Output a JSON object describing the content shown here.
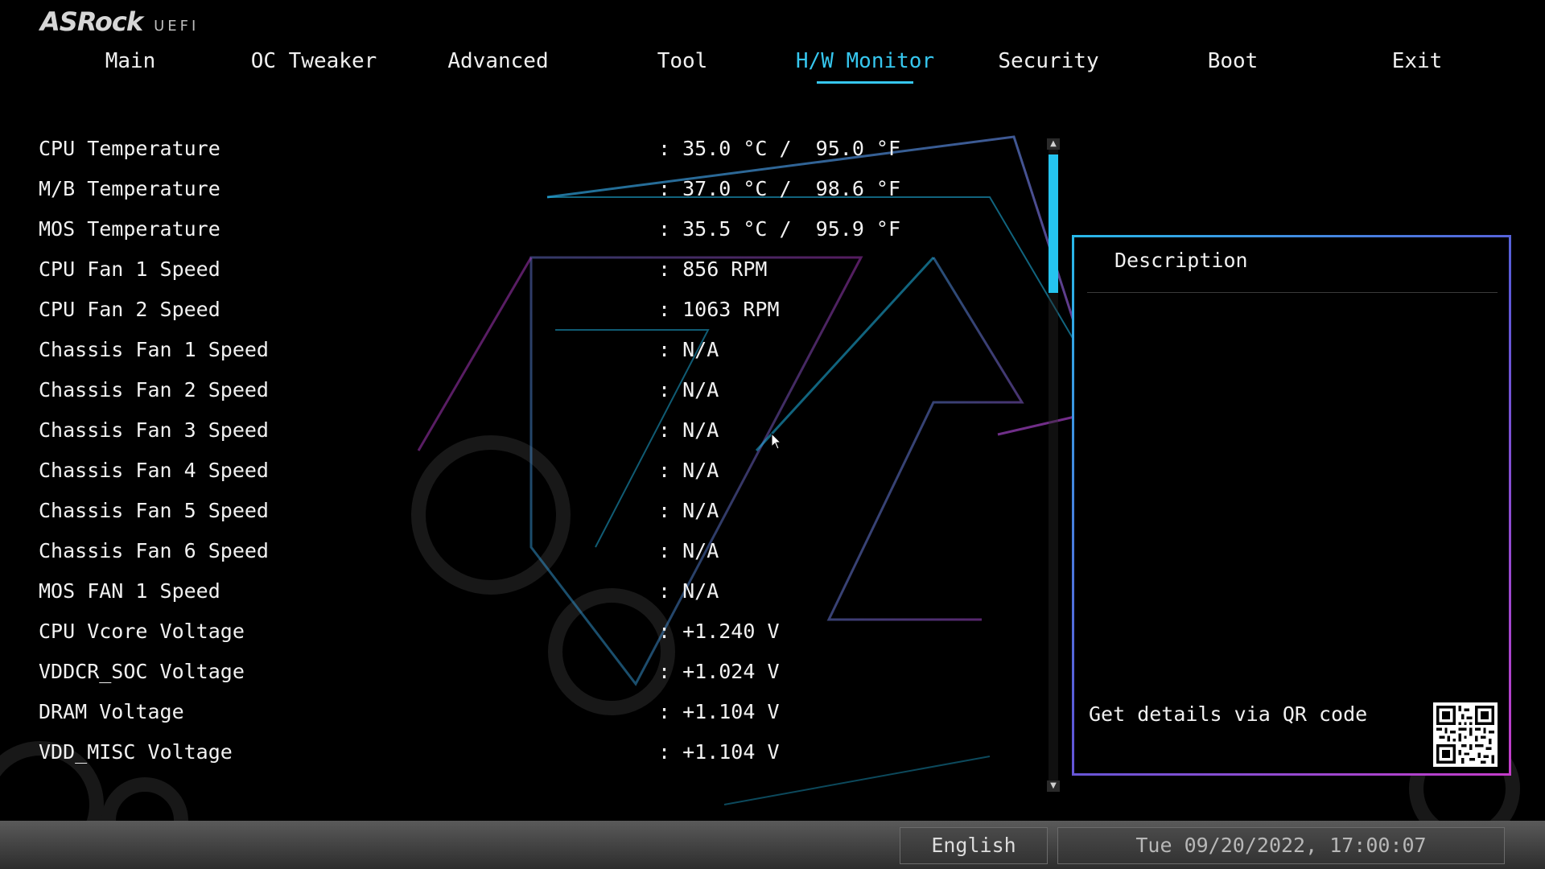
{
  "logo": {
    "brand": "ASRock",
    "product": "UEFI"
  },
  "menu": {
    "tabs": [
      {
        "label": "Main",
        "active": false
      },
      {
        "label": "OC Tweaker",
        "active": false
      },
      {
        "label": "Advanced",
        "active": false
      },
      {
        "label": "Tool",
        "active": false
      },
      {
        "label": "H/W Monitor",
        "active": true
      },
      {
        "label": "Security",
        "active": false
      },
      {
        "label": "Boot",
        "active": false
      },
      {
        "label": "Exit",
        "active": false
      }
    ]
  },
  "monitor": {
    "rows": [
      {
        "label": "CPU Temperature",
        "value": ": 35.0 °C /  95.0 °F"
      },
      {
        "label": "M/B Temperature",
        "value": ": 37.0 °C /  98.6 °F"
      },
      {
        "label": "MOS Temperature",
        "value": ": 35.5 °C /  95.9 °F"
      },
      {
        "label": "CPU Fan 1 Speed",
        "value": ": 856 RPM"
      },
      {
        "label": "CPU Fan 2 Speed",
        "value": ": 1063 RPM"
      },
      {
        "label": "Chassis Fan 1 Speed",
        "value": ": N/A"
      },
      {
        "label": "Chassis Fan 2 Speed",
        "value": ": N/A"
      },
      {
        "label": "Chassis Fan 3 Speed",
        "value": ": N/A"
      },
      {
        "label": "Chassis Fan 4 Speed",
        "value": ": N/A"
      },
      {
        "label": "Chassis Fan 5 Speed",
        "value": ": N/A"
      },
      {
        "label": "Chassis Fan 6 Speed",
        "value": ": N/A"
      },
      {
        "label": "MOS FAN 1 Speed",
        "value": ": N/A"
      },
      {
        "label": "CPU Vcore Voltage",
        "value": ": +1.240 V"
      },
      {
        "label": "VDDCR_SOC Voltage",
        "value": ": +1.024 V"
      },
      {
        "label": "DRAM Voltage",
        "value": ": +1.104 V"
      },
      {
        "label": "VDD_MISC Voltage",
        "value": ": +1.104 V"
      }
    ]
  },
  "description": {
    "title": "Description",
    "qr_text": "Get details via QR code",
    "qr_icon": "qr-code-icon"
  },
  "footer": {
    "language": "English",
    "datetime": "Tue 09/20/2022, 17:00:07"
  },
  "colors": {
    "accent": "#36c7ef",
    "scroll_thumb": "#25c4f0",
    "panel_border_start": "#28b9e8",
    "panel_border_end": "#c43cc9"
  }
}
